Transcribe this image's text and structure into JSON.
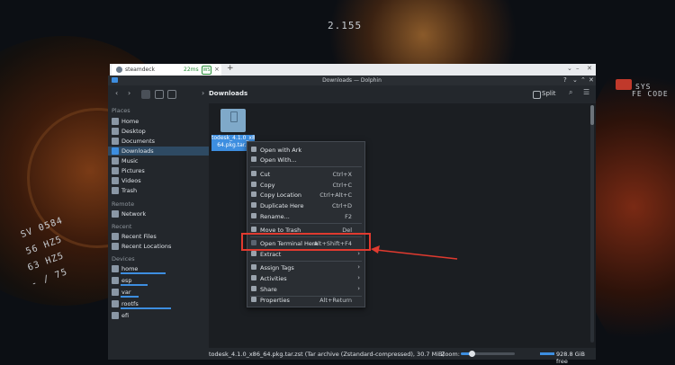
{
  "wallpaper": {
    "hud_top": "2.155",
    "hud_left_1": "SV 0584",
    "hud_left_2": "56 HZ5",
    "hud_left_3": "63 HZ5",
    "hud_left_4": "- / 75",
    "hud_right_1": "SYS",
    "hud_right_2": "FE CODE"
  },
  "browser_tab": {
    "title": "steamdeck",
    "latency": "22ms",
    "badge": "WS",
    "close": "×",
    "new_tab": "+"
  },
  "browser_controls": {
    "minimize": "⌄",
    "maximize": "–",
    "close": "✕"
  },
  "window": {
    "title": "Downloads — Dolphin",
    "controls": {
      "help": "?",
      "minimize": "⌄",
      "maximize": "⌃",
      "close": "✕"
    },
    "toolbar": {
      "back": "‹",
      "forward": "›",
      "breadcrumb_arrow": "›",
      "breadcrumb": "Downloads",
      "split": "Split"
    }
  },
  "sidebar": {
    "sections": [
      {
        "title": "Places",
        "items": [
          "Home",
          "Desktop",
          "Documents",
          "Downloads",
          "Music",
          "Pictures",
          "Videos",
          "Trash"
        ]
      },
      {
        "title": "Remote",
        "items": [
          "Network"
        ]
      },
      {
        "title": "Recent",
        "items": [
          "Recent Files",
          "Recent Locations"
        ]
      },
      {
        "title": "Devices",
        "items": [
          "home",
          "esp",
          "var",
          "rootfs",
          "efi"
        ]
      }
    ],
    "selected": "Downloads"
  },
  "file": {
    "name_line1": "todesk_4.1.0_x86",
    "name_line2": "64.pkg.tar.z"
  },
  "status": {
    "text": "todesk_4.1.0_x86_64.pkg.tar.zst (Tar archive (Zstandard-compressed), 30.7 MiB)",
    "zoom": "Zoom:",
    "zoom_level": 0.2,
    "free": "928.8 GiB free"
  },
  "context_menu": {
    "items": [
      {
        "label": "Open with Ark",
        "shortcut": ""
      },
      {
        "label": "Open With...",
        "shortcut": ""
      },
      {
        "label": "Cut",
        "shortcut": "Ctrl+X"
      },
      {
        "label": "Copy",
        "shortcut": "Ctrl+C"
      },
      {
        "label": "Copy Location",
        "shortcut": "Ctrl+Alt+C"
      },
      {
        "label": "Duplicate Here",
        "shortcut": "Ctrl+D"
      },
      {
        "label": "Rename...",
        "shortcut": "F2"
      },
      {
        "label": "Move to Trash",
        "shortcut": "Del"
      },
      {
        "label": "Open Terminal Here",
        "shortcut": "Alt+Shift+F4"
      },
      {
        "label": "Extract",
        "shortcut": ""
      },
      {
        "label": "Assign Tags",
        "shortcut": ""
      },
      {
        "label": "Activities",
        "shortcut": ""
      },
      {
        "label": "Share",
        "shortcut": ""
      },
      {
        "label": "Properties",
        "shortcut": "Alt+Return"
      }
    ],
    "submenu_arrow": "›"
  },
  "colors": {
    "accent": "#3d8ee0",
    "annotation": "#e03a2f",
    "menu_bg": "#2a2e33"
  }
}
